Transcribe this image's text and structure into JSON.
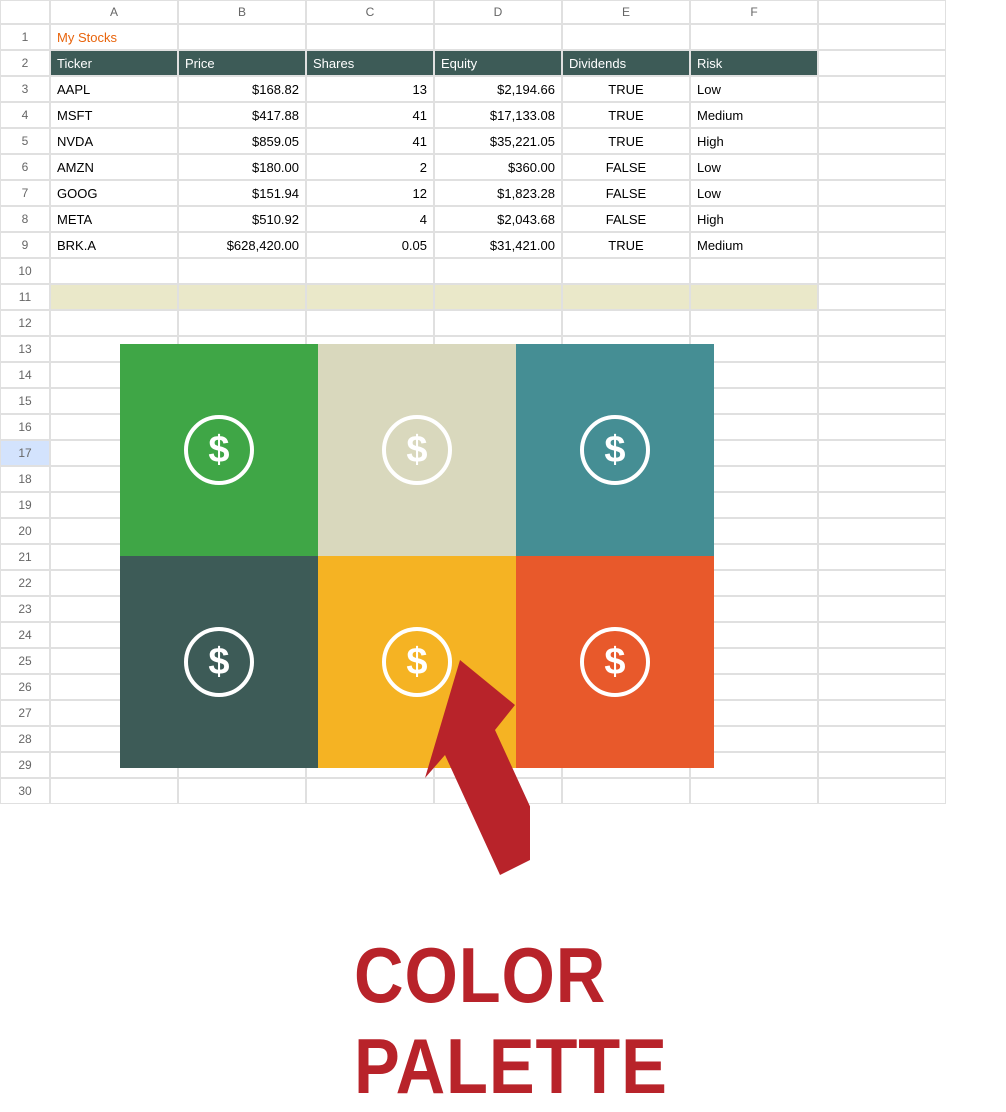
{
  "title": "My Stocks",
  "columns": [
    "A",
    "B",
    "C",
    "D",
    "E",
    "F",
    ""
  ],
  "row_numbers": [
    1,
    2,
    3,
    4,
    5,
    6,
    7,
    8,
    9,
    10,
    11,
    12,
    13,
    14,
    15,
    16,
    17,
    18,
    19,
    20,
    21,
    22,
    23,
    24,
    25,
    26,
    27,
    28,
    29,
    30
  ],
  "selected_row": 17,
  "table": {
    "headers": [
      "Ticker",
      "Price",
      "Shares",
      "Equity",
      "Dividends",
      "Risk"
    ],
    "rows": [
      {
        "ticker": "AAPL",
        "price": "$168.82",
        "shares": "13",
        "equity": "$2,194.66",
        "dividends": "TRUE",
        "risk": "Low"
      },
      {
        "ticker": "MSFT",
        "price": "$417.88",
        "shares": "41",
        "equity": "$17,133.08",
        "dividends": "TRUE",
        "risk": "Medium"
      },
      {
        "ticker": "NVDA",
        "price": "$859.05",
        "shares": "41",
        "equity": "$35,221.05",
        "dividends": "TRUE",
        "risk": "High"
      },
      {
        "ticker": "AMZN",
        "price": "$180.00",
        "shares": "2",
        "equity": "$360.00",
        "dividends": "FALSE",
        "risk": "Low"
      },
      {
        "ticker": "GOOG",
        "price": "$151.94",
        "shares": "12",
        "equity": "$1,823.28",
        "dividends": "FALSE",
        "risk": "Low"
      },
      {
        "ticker": "META",
        "price": "$510.92",
        "shares": "4",
        "equity": "$2,043.68",
        "dividends": "FALSE",
        "risk": "High"
      },
      {
        "ticker": "BRK.A",
        "price": "$628,420.00",
        "shares": "0.05",
        "equity": "$31,421.00",
        "dividends": "TRUE",
        "risk": "Medium"
      }
    ]
  },
  "palette": {
    "colors": [
      "#3fa646",
      "#d9d8bd",
      "#458e94",
      "#3d5b57",
      "#f5b323",
      "#e8592b"
    ],
    "label": "COLOR PALETTE"
  },
  "arrow_color": "#b8232a"
}
